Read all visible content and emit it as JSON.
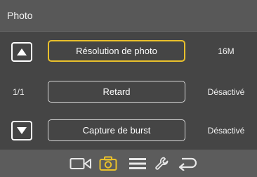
{
  "header": {
    "title": "Photo"
  },
  "page_indicator": "1/1",
  "rows": [
    {
      "label": "Résolution de photo",
      "value": "16M",
      "selected": true
    },
    {
      "label": "Retard",
      "value": "Désactivé",
      "selected": false
    },
    {
      "label": "Capture de burst",
      "value": "Désactivé",
      "selected": false
    }
  ],
  "footer": {
    "icons": [
      "video-icon",
      "camera-icon",
      "menu-icon",
      "wrench-icon",
      "back-icon"
    ],
    "active": "camera-icon"
  },
  "colors": {
    "accent": "#e9c02b",
    "background": "#454545",
    "header": "#585858",
    "footer": "#5c5c5c"
  }
}
